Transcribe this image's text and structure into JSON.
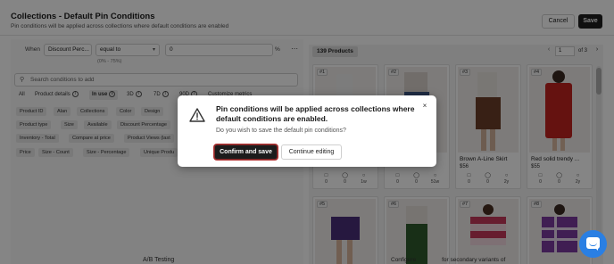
{
  "header": {
    "title": "Collections - Default Pin Conditions",
    "subtitle": "Pin conditions will be applied across collections where default conditions are enabled",
    "cancel_label": "Cancel",
    "save_label": "Save"
  },
  "condition": {
    "when_label": "When",
    "field_value": "Discount Perc...",
    "operator_value": "equal to",
    "input_value": "0",
    "unit": "%",
    "range_hint": "(0% - 75%)"
  },
  "search": {
    "placeholder": "Search conditions to add"
  },
  "filter_tabs": [
    {
      "label": "All"
    },
    {
      "label": "Product details"
    },
    {
      "label": "In use"
    },
    {
      "label": "3D"
    },
    {
      "label": "7D"
    },
    {
      "label": "90D"
    },
    {
      "label": "Customize metrics"
    }
  ],
  "chips": [
    [
      "Product ID",
      "Alan",
      "Collections",
      "Color",
      "Design"
    ],
    [
      "Product type",
      "Size",
      "Available",
      "Discount Percentage"
    ],
    [
      "Inventory - Total",
      "Compare at price",
      "Product Views (last"
    ],
    [
      "Price",
      "Size - Count",
      "Size - Percentage",
      "Unique Produ"
    ]
  ],
  "products": {
    "count_label": "139 Products",
    "page_value": "1",
    "page_of": "of 3",
    "cards": [
      {
        "rank": "#1",
        "name": "",
        "price": "",
        "stats": [
          "0",
          "0",
          "1w"
        ]
      },
      {
        "rank": "#2",
        "name": "",
        "price": "",
        "stats": [
          "0",
          "0",
          "51w"
        ]
      },
      {
        "rank": "#3",
        "name": "Brown A-Line Skirt",
        "price": "$56",
        "stats": [
          "0",
          "0",
          "2y"
        ]
      },
      {
        "rank": "#4",
        "name": "Red solid trendy ...",
        "price": "$55",
        "stats": [
          "0",
          "0",
          "2y"
        ]
      },
      {
        "rank": "#5"
      },
      {
        "rank": "#6"
      },
      {
        "rank": "#7"
      },
      {
        "rank": "#8"
      }
    ]
  },
  "bottom": {
    "ab_testing": "A/B Testing",
    "configure_text": "Configure                  for secondary variants of"
  },
  "dialog": {
    "title": "Pin conditions will be applied across collections where default conditions are enabled.",
    "body": "Do you wish to save the default pin conditions?",
    "confirm_label": "Confirm and save",
    "continue_label": "Continue editing",
    "close_glyph": "×"
  },
  "colors": {
    "primary_button": "#1c1c1c",
    "confirm_outline": "#b03030",
    "chat_widget": "#2a7fe3"
  }
}
